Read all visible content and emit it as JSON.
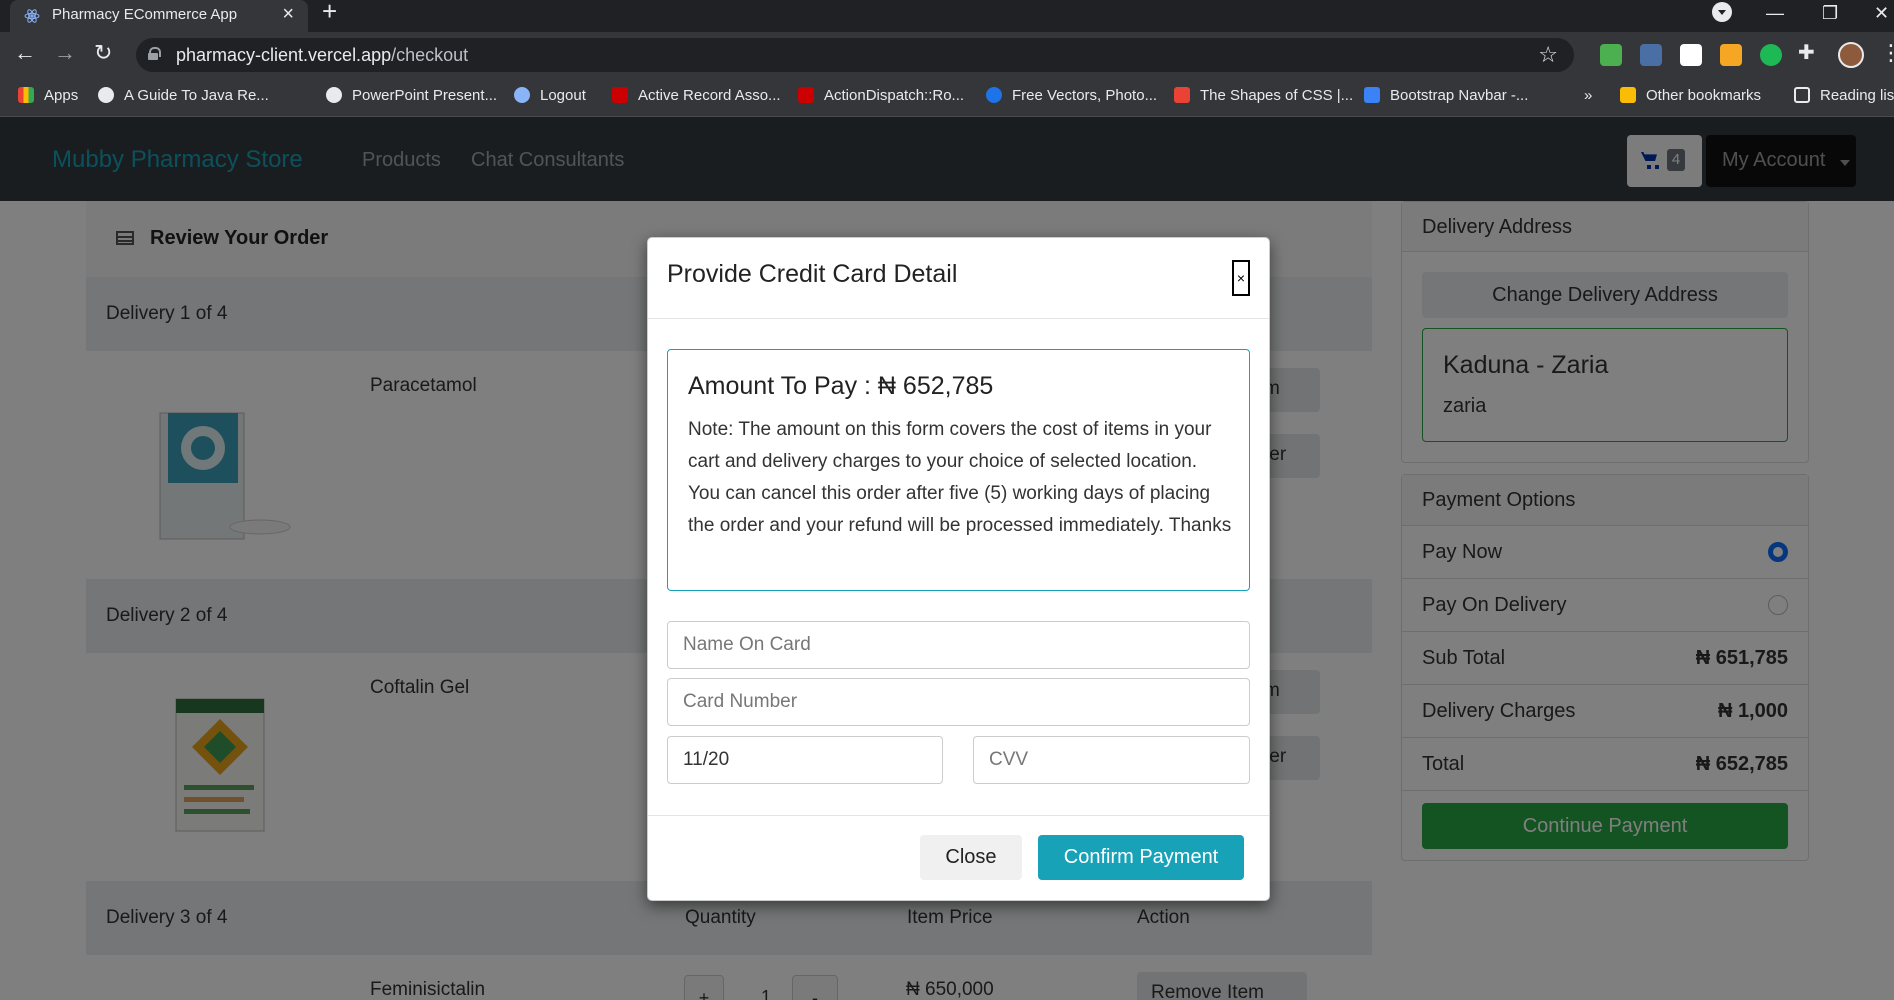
{
  "browser": {
    "tab_title": "Pharmacy ECommerce App",
    "tab_close": "×",
    "new_tab": "+",
    "url_host": "pharmacy-client.vercel.app",
    "url_path": "/checkout",
    "bookmarks": [
      "Apps",
      "A Guide To Java Re...",
      "PowerPoint Present...",
      "Logout",
      "Active Record Asso...",
      "ActionDispatch::Ro...",
      "Free Vectors, Photo...",
      "The Shapes of CSS |...",
      "Bootstrap Navbar -...",
      "»",
      "Other bookmarks",
      "Reading list"
    ]
  },
  "navbar": {
    "brand": "Mubby Pharmacy Store",
    "links": [
      "Products",
      "Chat Consultants"
    ],
    "cart_count": "4",
    "account": "My Account"
  },
  "review": {
    "title": "Review Your Order",
    "deliveries": [
      {
        "label": "Delivery 1 of 4",
        "product": "Paracetamol"
      },
      {
        "label": "Delivery 2 of 4",
        "product": "Coftalin Gel"
      },
      {
        "label": "Delivery 3 of 4",
        "product": "Feminisictalin",
        "price": "₦ 650,000",
        "qty": "1"
      }
    ],
    "headers": {
      "quantity": "Quantity",
      "item_price": "Item Price",
      "action": "Action"
    },
    "btn_fragments": [
      "m",
      "ter",
      "m",
      "ter"
    ],
    "qty_plus": "+",
    "qty_minus": "-",
    "remove_label": "Remove Item"
  },
  "sidebar": {
    "delivery_title": "Delivery Address",
    "change_address": "Change Delivery Address",
    "address_city": "Kaduna - Zaria",
    "address_sub": "zaria",
    "payment_title": "Payment Options",
    "options": [
      {
        "label": "Pay Now",
        "selected": true
      },
      {
        "label": "Pay On Delivery",
        "selected": false
      }
    ],
    "subtotal_label": "Sub Total",
    "subtotal": "₦ 651,785",
    "delivery_label": "Delivery Charges",
    "delivery_charges": "₦ 1,000",
    "total_label": "Total",
    "total": "₦ 652,785",
    "continue": "Continue Payment"
  },
  "modal": {
    "title": "Provide Credit Card Detail",
    "close_x": "×",
    "amount": "Amount To Pay : ₦ 652,785",
    "note": "Note: The amount on this form covers the cost of items in your cart and delivery charges to your choice of selected location. You can cancel this order after five (5) working days of placing the order and your refund will be processed immediately. Thanks",
    "name_placeholder": "Name On Card",
    "card_placeholder": "Card Number",
    "expiry_value": "11/20",
    "cvv_placeholder": "CVV",
    "close_btn": "Close",
    "confirm_btn": "Confirm Payment"
  },
  "colors": {
    "brand": "#17a2b8",
    "success": "#28a745",
    "navbar": "#343a40",
    "radio": "#0d6efd"
  }
}
